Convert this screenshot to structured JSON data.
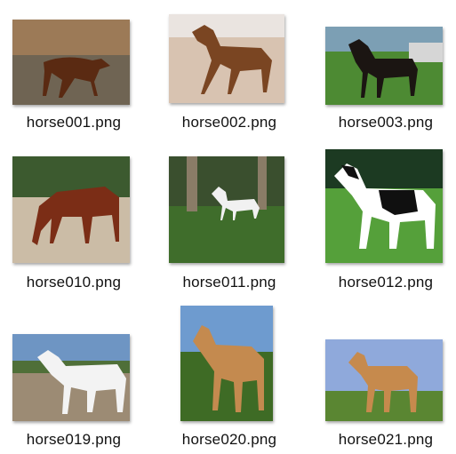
{
  "files": [
    {
      "name": "horse001.png",
      "thumb_icon": "horse-photo-icon"
    },
    {
      "name": "horse002.png",
      "thumb_icon": "horse-photo-icon"
    },
    {
      "name": "horse003.png",
      "thumb_icon": "horse-photo-icon"
    },
    {
      "name": "horse010.png",
      "thumb_icon": "horse-photo-icon"
    },
    {
      "name": "horse011.png",
      "thumb_icon": "horse-photo-icon"
    },
    {
      "name": "horse012.png",
      "thumb_icon": "horse-photo-icon"
    },
    {
      "name": "horse019.png",
      "thumb_icon": "horse-photo-icon"
    },
    {
      "name": "horse020.png",
      "thumb_icon": "horse-photo-icon"
    },
    {
      "name": "horse021.png",
      "thumb_icon": "horse-photo-icon"
    }
  ]
}
